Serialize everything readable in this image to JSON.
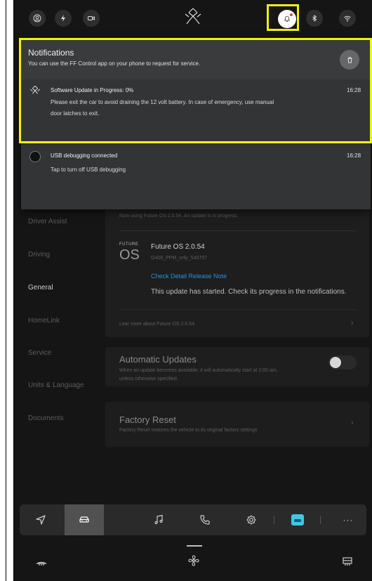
{
  "notifications": {
    "title": "Notifications",
    "subtitle": "You can use the FF Control app on your phone to request for service.",
    "items": [
      {
        "title": "Software Update in Progress: 0%",
        "time": "16:28",
        "body_line1": "Please exit the car to avoid draining the 12 volt battery. In case of emergency, use manual",
        "body_line2": "door latches to exit."
      },
      {
        "title": "USB debugging connected",
        "time": "16:28",
        "body_line1": "Tap to turn off USB debugging"
      }
    ]
  },
  "sidebar": {
    "items": [
      {
        "label": "Driver Assist"
      },
      {
        "label": "Driving"
      },
      {
        "label": "General"
      },
      {
        "label": "HomeLink"
      },
      {
        "label": "Service"
      },
      {
        "label": "Units & Language"
      },
      {
        "label": "Documents"
      }
    ],
    "active": "General"
  },
  "software": {
    "status_line": "Now using Future OS 2.0.54. An update is in progress.",
    "brand_top": "FUTURE",
    "brand_bottom": "OS",
    "version_title": "Future OS 2.0.54",
    "build": "G408_PPM_only_540707",
    "release_note_link": "Check Detail Release Note",
    "update_message": "This update has started. Check its progress in the notifications.",
    "learn_more": "Lear more about Future OS 2.0.54"
  },
  "auto_updates": {
    "title": "Automatic Updates",
    "desc_line1": "When an update becomes available, it will automatically start at 2:00 am,",
    "desc_line2": "unless otherwise specified.",
    "enabled": false
  },
  "factory_reset": {
    "title": "Factory Reset",
    "desc": "Factory Reset restores the vehicle to its original factory settings"
  },
  "dock": {
    "more_label": "···",
    "selected": "car"
  },
  "colors": {
    "highlight": "#f4f10a",
    "link": "#2f8fd6",
    "panel": "#333436",
    "background": "#151515"
  }
}
